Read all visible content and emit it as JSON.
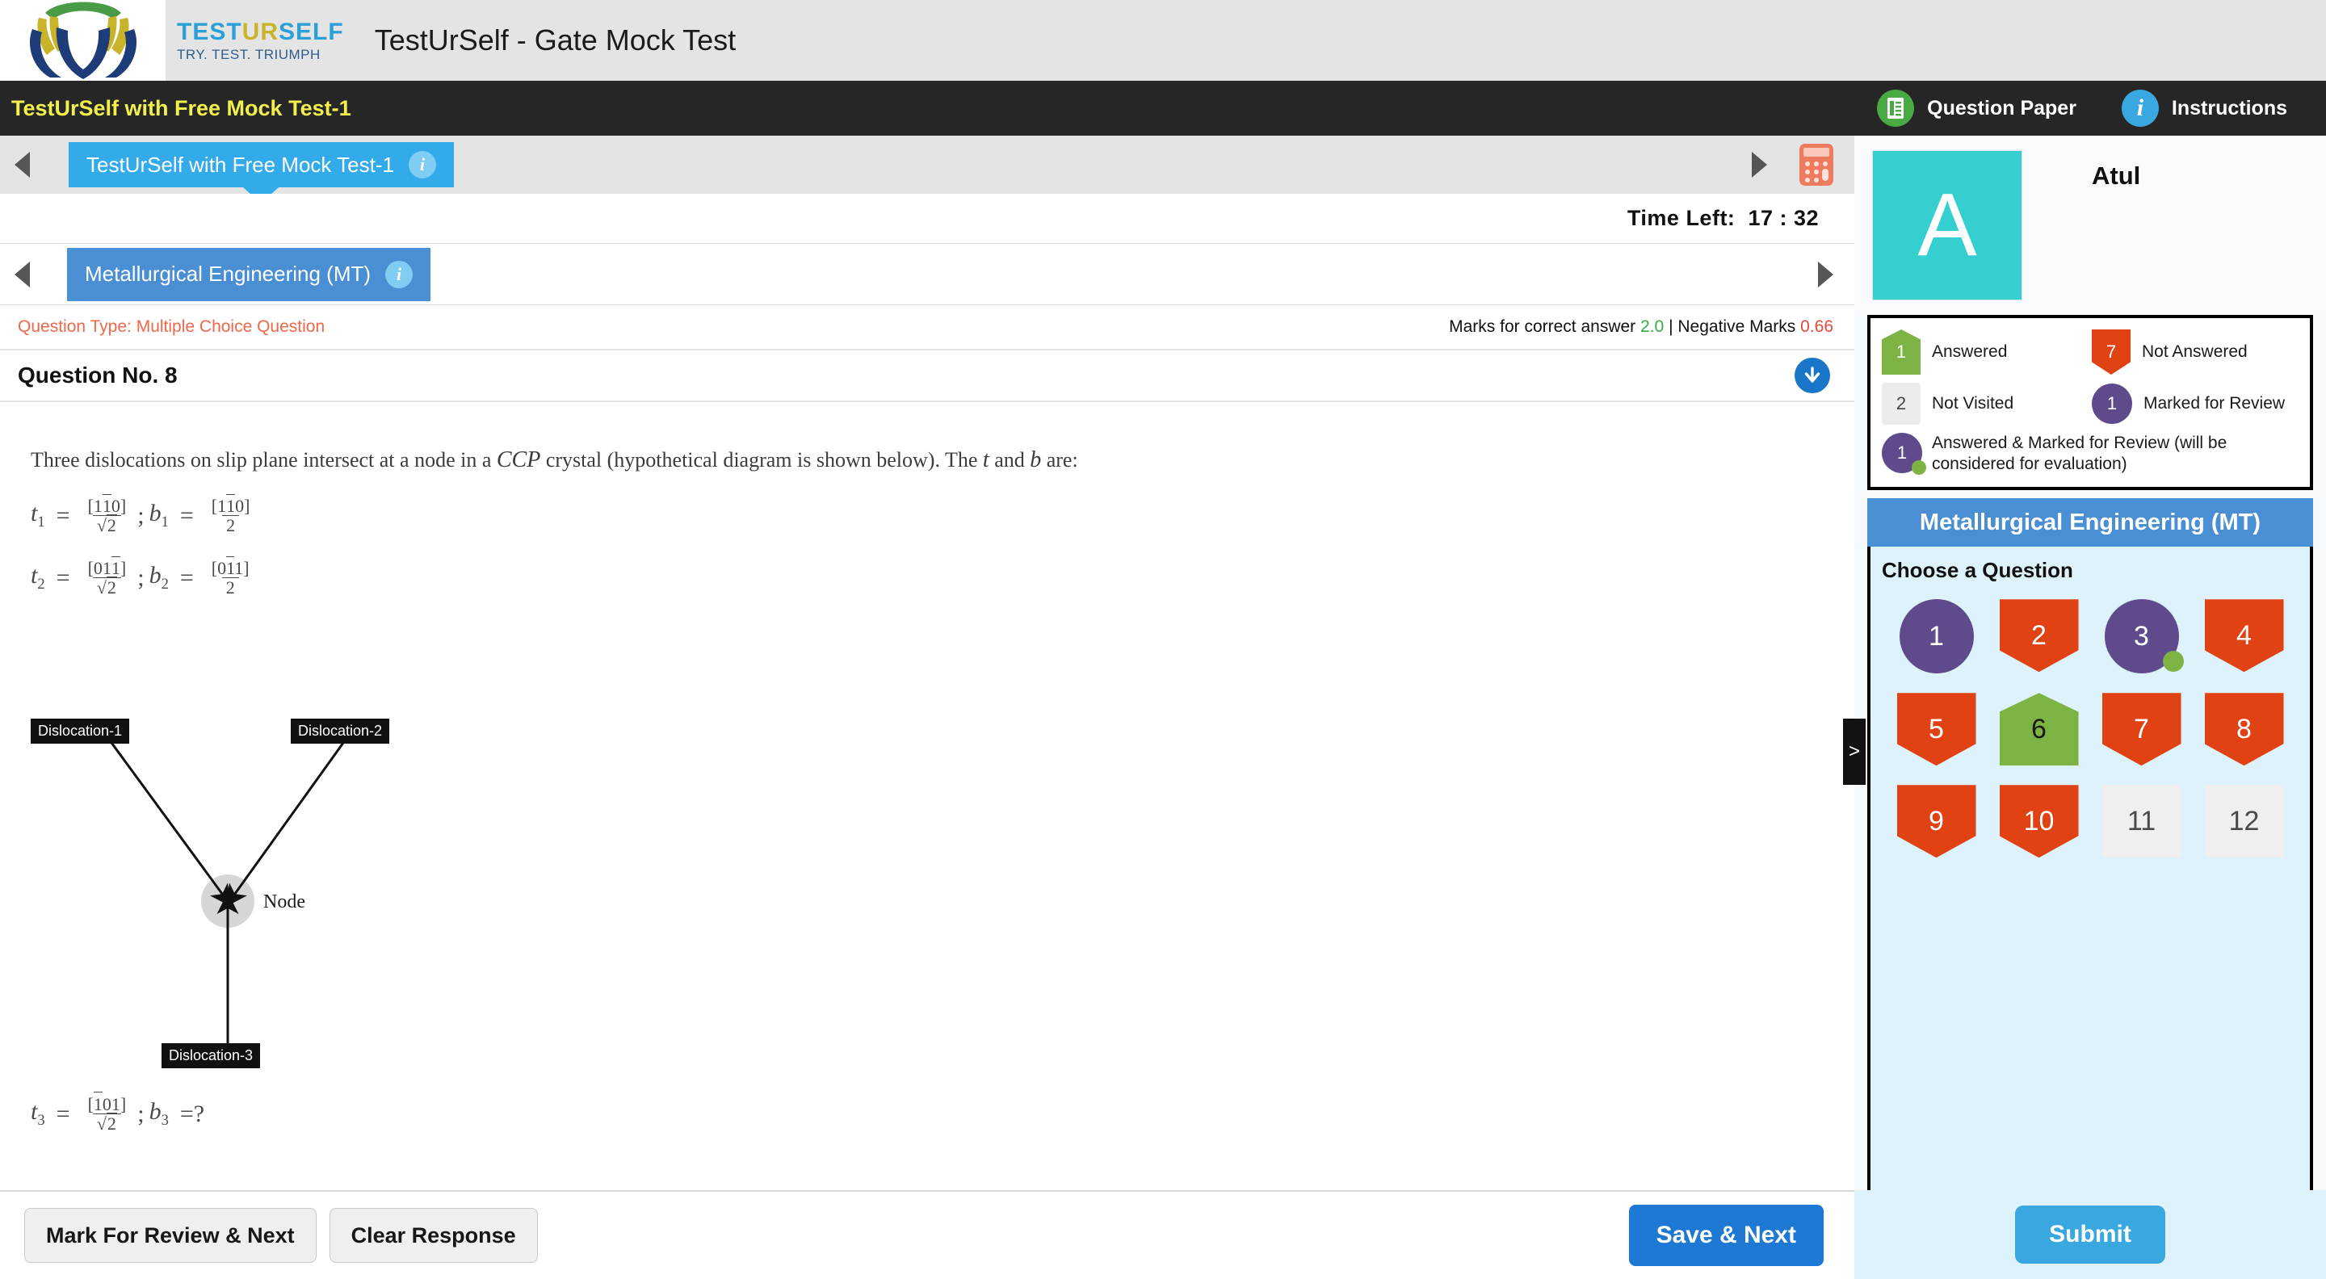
{
  "brand": {
    "word_test": "TEST",
    "word_ur": "UR",
    "word_self": "SELF",
    "tagline": "TRY. TEST. TRIUMPH",
    "app_title": "TestUrSelf - Gate Mock Test",
    "logo_icon": "hands-logo-icon"
  },
  "darkbar": {
    "test_name": "TestUrSelf with Free Mock Test-1",
    "question_paper_label": "Question Paper",
    "instructions_label": "Instructions",
    "question_paper_icon": "document-icon",
    "instructions_icon": "info-icon"
  },
  "test_tab": {
    "label": "TestUrSelf with Free Mock Test-1",
    "info_icon": "info-icon",
    "prev_icon": "triangle-left-icon",
    "next_icon": "triangle-right-icon",
    "calculator_icon": "calculator-icon"
  },
  "timer": {
    "label": "Time Left:",
    "value": "17 : 32"
  },
  "subject_tab": {
    "label": "Metallurgical Engineering (MT)",
    "info_icon": "info-icon",
    "prev_icon": "triangle-left-icon",
    "next_icon": "triangle-right-icon"
  },
  "marks": {
    "question_type": "Question Type: Multiple Choice Question",
    "prefix": "Marks for correct answer",
    "positive": "2.0",
    "separator": "|",
    "negative_label": "Negative Marks",
    "negative": "0.66"
  },
  "question": {
    "number_label": "Question No. 8",
    "scroll_icon": "arrow-down-circle-icon",
    "text_part1": "Three dislocations on slip plane intersect at a node in a",
    "text_crystal": "CCP",
    "text_part2": "crystal (hypothetical diagram is shown below). The",
    "text_t": "t",
    "text_and": "and",
    "text_b": "b",
    "text_part3": "are:",
    "math": [
      {
        "lhs_var": "t",
        "lhs_sub": "1",
        "lhs_num": "[110]",
        "lhs_den": "√2",
        "rhs_var": "b",
        "rhs_sub": "1",
        "rhs_num": "[110]",
        "rhs_den": "2"
      },
      {
        "lhs_var": "t",
        "lhs_sub": "2",
        "lhs_num": "[011]",
        "lhs_den": "√2",
        "rhs_var": "b",
        "rhs_sub": "2",
        "rhs_num": "[011]",
        "rhs_den": "2"
      }
    ],
    "math_final": {
      "lhs_var": "t",
      "lhs_sub": "3",
      "lhs_num": "[101]",
      "lhs_den": "√2",
      "rhs_var": "b",
      "rhs_sub": "3",
      "rhs_answer": "=?"
    },
    "diagram": {
      "label1": "Dislocation-1",
      "label2": "Dislocation-2",
      "label3": "Dislocation-3",
      "node_label": "Node"
    }
  },
  "actions": {
    "mark_review": "Mark For Review & Next",
    "clear_response": "Clear Response",
    "save_next": "Save & Next",
    "submit": "Submit"
  },
  "profile": {
    "avatar_letter": "A",
    "name": "Atul"
  },
  "legend": [
    {
      "count": "1",
      "label": "Answered",
      "state": "answered"
    },
    {
      "count": "7",
      "label": "Not Answered",
      "state": "not-answered"
    },
    {
      "count": "2",
      "label": "Not Visited",
      "state": "not-visited"
    },
    {
      "count": "1",
      "label": "Marked for Review",
      "state": "review"
    },
    {
      "count": "1",
      "label": "Answered & Marked for Review (will be considered for evaluation)",
      "state": "answered-review"
    }
  ],
  "palette": {
    "subject_header": "Metallurgical Engineering (MT)",
    "choose_label": "Choose a Question",
    "questions": [
      {
        "n": "1",
        "state": "review"
      },
      {
        "n": "2",
        "state": "not-answered"
      },
      {
        "n": "3",
        "state": "answered-review"
      },
      {
        "n": "4",
        "state": "not-answered"
      },
      {
        "n": "5",
        "state": "not-answered"
      },
      {
        "n": "6",
        "state": "answered"
      },
      {
        "n": "7",
        "state": "not-answered"
      },
      {
        "n": "8",
        "state": "not-answered"
      },
      {
        "n": "9",
        "state": "not-answered"
      },
      {
        "n": "10",
        "state": "not-answered"
      },
      {
        "n": "11",
        "state": "not-visited"
      },
      {
        "n": "12",
        "state": "not-visited"
      }
    ]
  },
  "collapse_handle": {
    "icon": "chevron-right-icon",
    "glyph": ">"
  },
  "colors": {
    "accent_blue": "#33aaea",
    "subject_blue": "#4a8fd4",
    "answered_green": "#7cb342",
    "not_answered_red": "#e04213",
    "review_purple": "#5f4b8b",
    "not_visited_gray": "#f0eeee",
    "dark_bar": "#262626",
    "yellow_title": "#f2f04a",
    "avatar_teal": "#34cfce"
  }
}
